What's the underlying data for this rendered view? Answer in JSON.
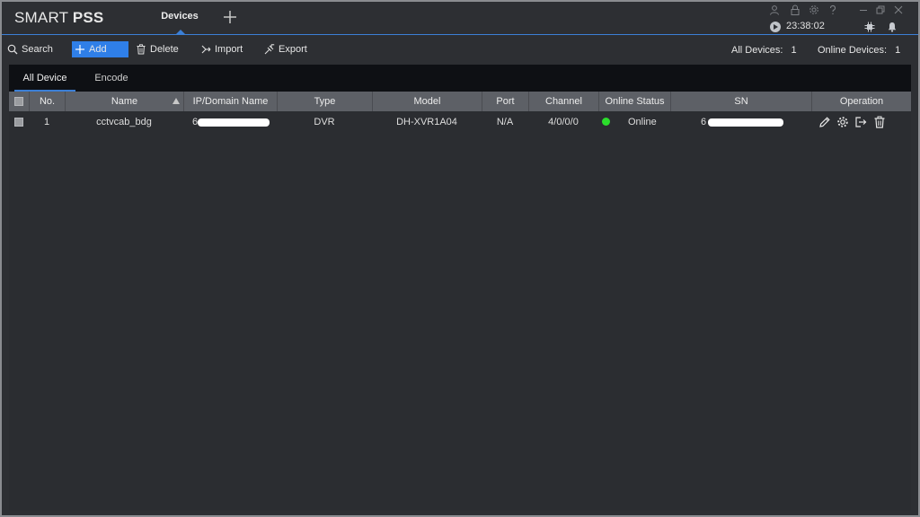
{
  "app": {
    "logo_light": "SMART ",
    "logo_bold": "PSS",
    "active_tab": "Devices",
    "time": "23:38:02",
    "icons": [
      "user-icon",
      "lock-icon",
      "settings-icon",
      "help-icon",
      "minimize-icon",
      "restore-icon",
      "close-icon",
      "cpu-icon",
      "bell-icon"
    ]
  },
  "toolbar": {
    "search_label": "Search",
    "add_label": "Add",
    "delete_label": "Delete",
    "import_label": "Import",
    "export_label": "Export",
    "all_devices_label": "All Devices:",
    "all_devices_count": "1",
    "online_devices_label": "Online Devices:",
    "online_devices_count": "1",
    "accent_color": "#2f7fe8"
  },
  "subtabs": [
    "All Device",
    "Encode Device"
  ],
  "table": {
    "headers": [
      "No.",
      "Name",
      "IP/Domain Name",
      "Type",
      "Model",
      "Port",
      "Channel Number",
      "Online Status",
      "SN",
      "Operation"
    ],
    "rows": [
      {
        "no": "1",
        "name": "cctvcab_bdg",
        "ip_prefix": "6",
        "type": "DVR",
        "model": "DH-XVR1A04",
        "port": "N/A",
        "channel_number": "4/0/0/0",
        "online_status": "Online",
        "online_color": "#2bdd2b",
        "sn_prefix": "6"
      }
    ]
  }
}
